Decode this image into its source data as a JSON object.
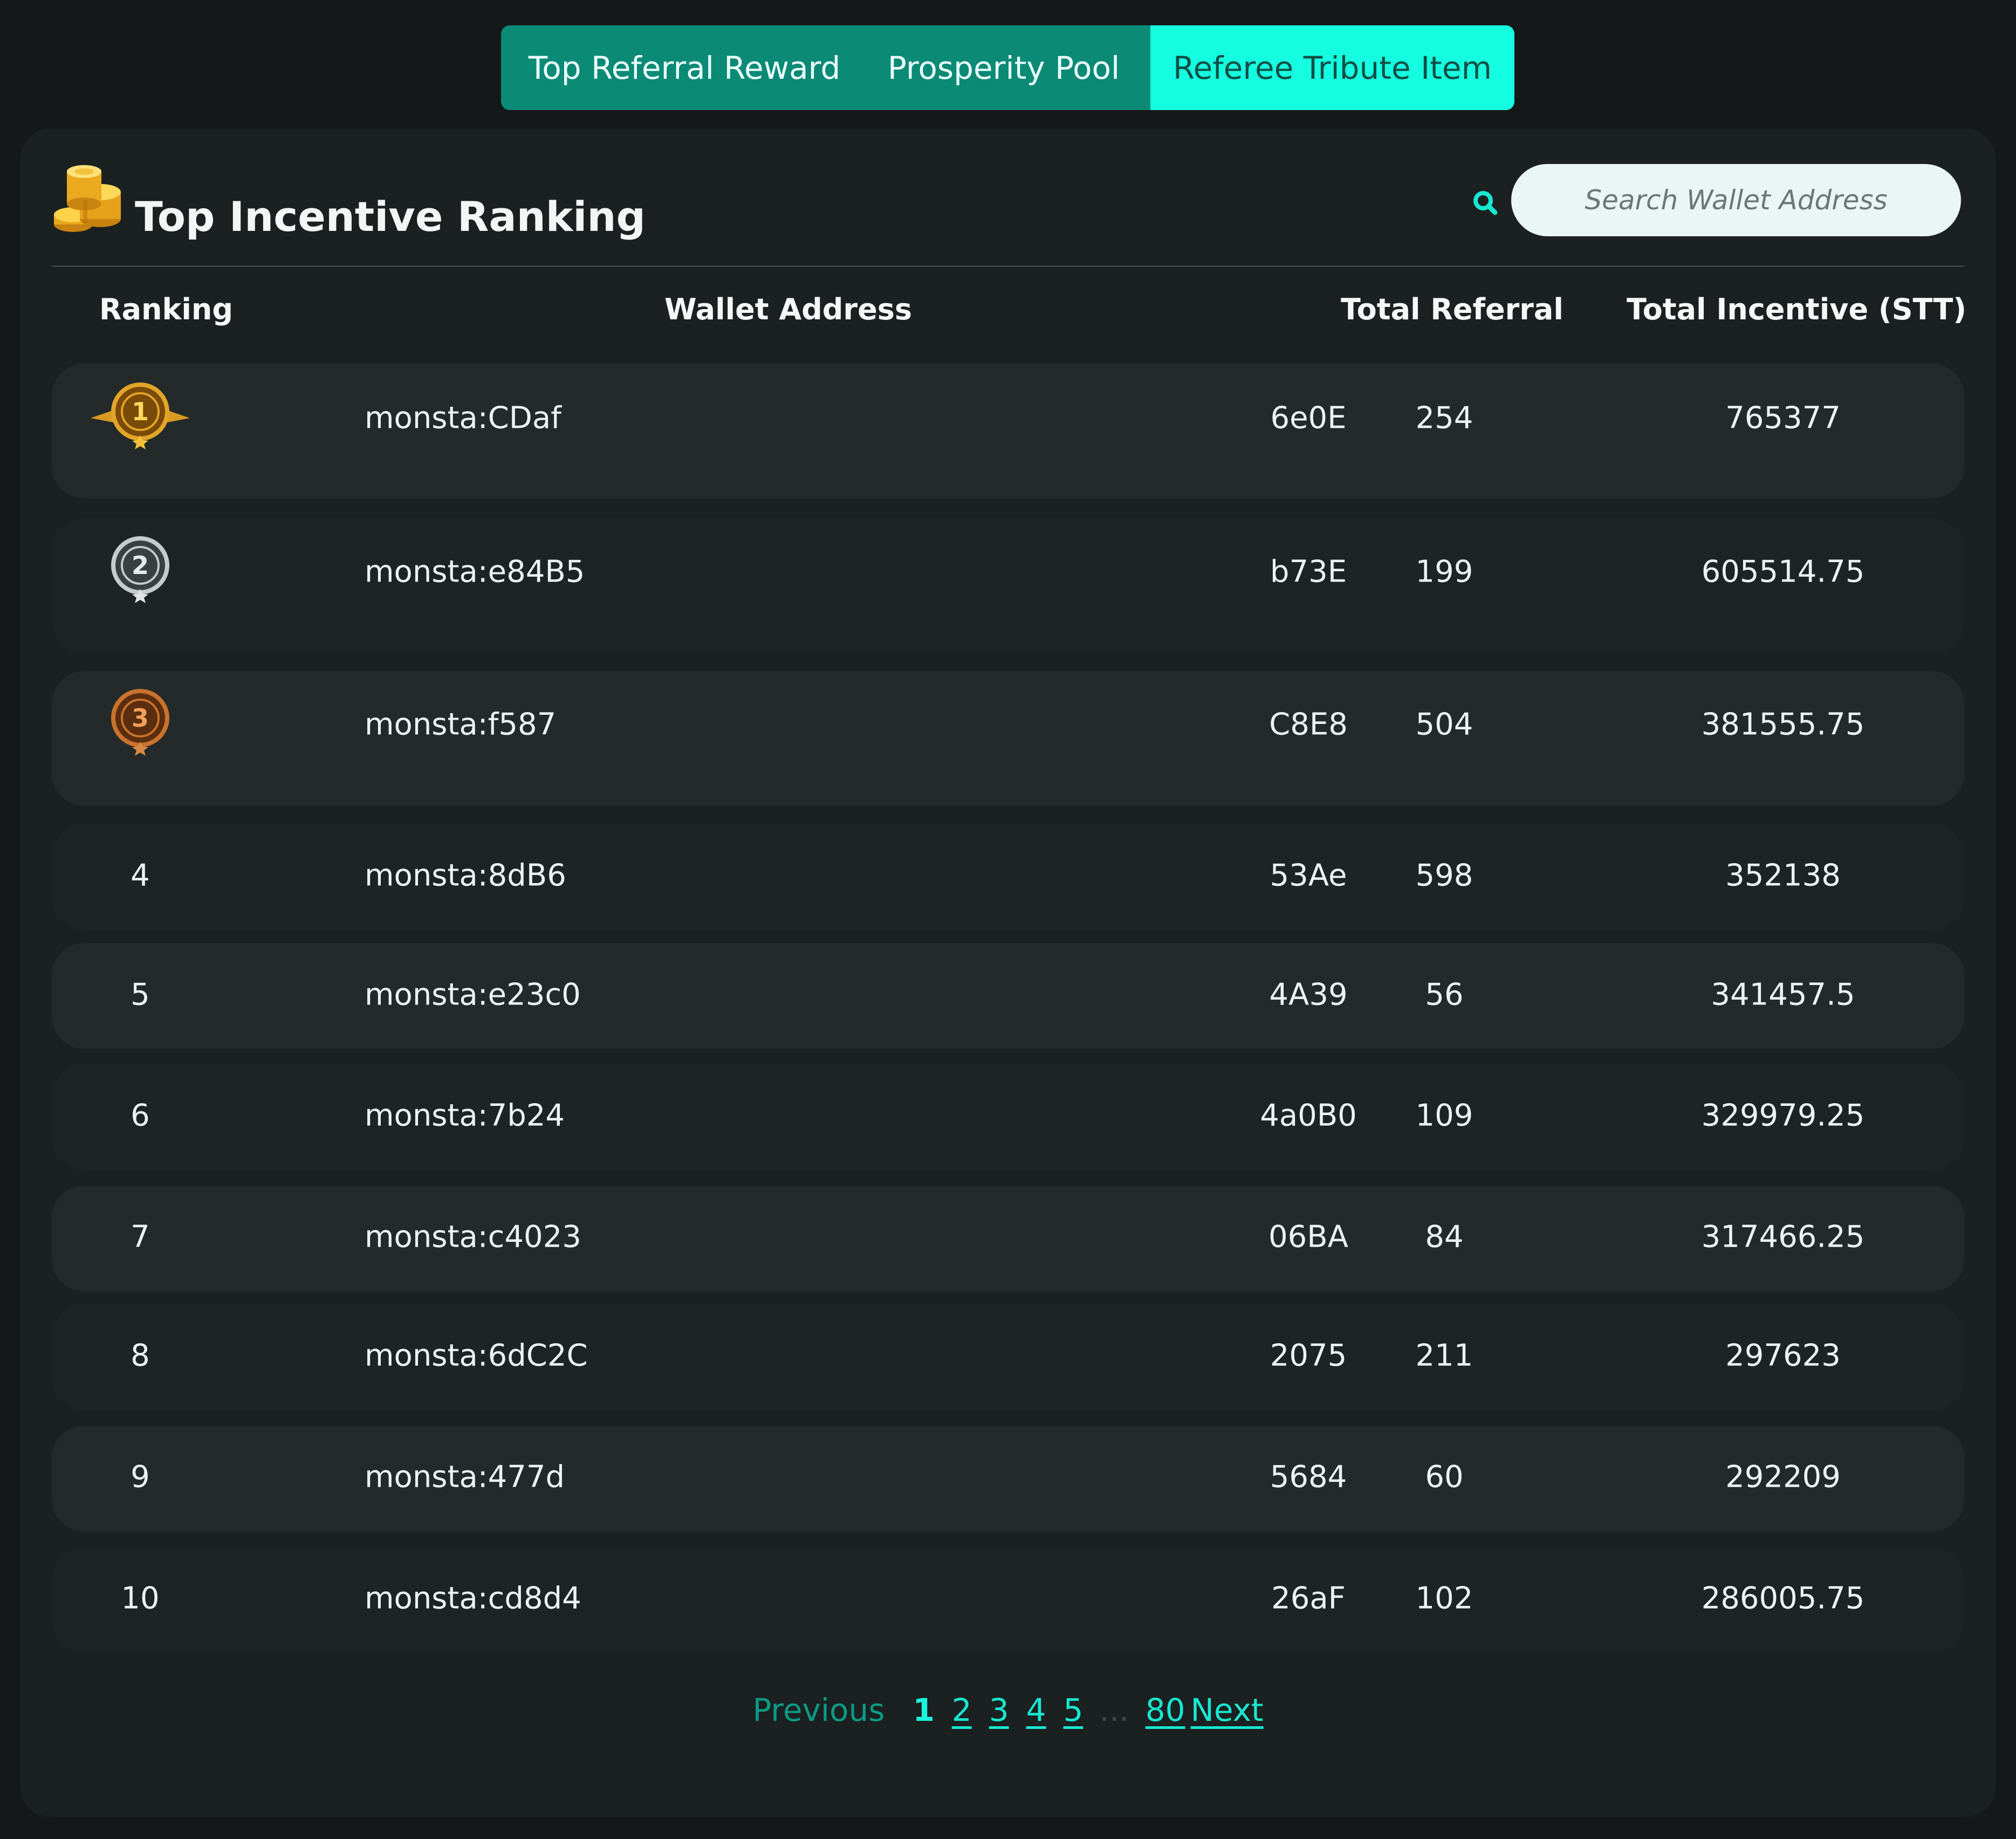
{
  "tabs": [
    {
      "label": "Top Referral Reward",
      "active": false
    },
    {
      "label": "Prosperity Pool",
      "active": false
    },
    {
      "label": "Referee Tribute Item",
      "active": true
    }
  ],
  "panel": {
    "icon": "gold-coins-icon",
    "title": "Top Incentive Ranking"
  },
  "search": {
    "icon": "search-icon",
    "placeholder": "Search Wallet Address"
  },
  "table": {
    "columns": [
      "Ranking",
      "Wallet Address",
      "Total Referral",
      "Total Incentive (STT)"
    ],
    "rows": [
      {
        "rank": "1",
        "medal": "gold",
        "address_start": "monsta:CDaf",
        "address_end": "6e0E",
        "referral": "254",
        "incentive": "765377"
      },
      {
        "rank": "2",
        "medal": "silver",
        "address_start": "monsta:e84B5",
        "address_end": "b73E",
        "referral": "199",
        "incentive": "605514.75"
      },
      {
        "rank": "3",
        "medal": "bronze",
        "address_start": "monsta:f587",
        "address_end": "C8E8",
        "referral": "504",
        "incentive": "381555.75"
      },
      {
        "rank": "4",
        "address_start": "monsta:8dB6",
        "address_end": "53Ae",
        "referral": "598",
        "incentive": "352138"
      },
      {
        "rank": "5",
        "address_start": "monsta:e23c0",
        "address_end": "4A39",
        "referral": "56",
        "incentive": "341457.5"
      },
      {
        "rank": "6",
        "address_start": "monsta:7b24",
        "address_end": "4a0B0",
        "referral": "109",
        "incentive": "329979.25"
      },
      {
        "rank": "7",
        "address_start": "monsta:c4023",
        "address_end": "06BA",
        "referral": "84",
        "incentive": "317466.25"
      },
      {
        "rank": "8",
        "address_start": "monsta:6dC2C",
        "address_end": "2075",
        "referral": "211",
        "incentive": "297623"
      },
      {
        "rank": "9",
        "address_start": "monsta:477d",
        "address_end": "5684",
        "referral": "60",
        "incentive": "292209"
      },
      {
        "rank": "10",
        "address_start": "monsta:cd8d4",
        "address_end": "26aF",
        "referral": "102",
        "incentive": "286005.75"
      }
    ]
  },
  "pagination": {
    "previous": "Previous",
    "pages": [
      "1",
      "2",
      "3",
      "4",
      "5"
    ],
    "current": "1",
    "ellipsis": "...",
    "last": "80",
    "next": "Next"
  },
  "colors": {
    "accent": "#15fde0",
    "tab_bar": "#0b8a76",
    "panel_bg": "#1b2020",
    "page_bg": "#151818",
    "gold": "#e2a52a",
    "silver": "#c7cbcc",
    "bronze": "#c9732e"
  }
}
